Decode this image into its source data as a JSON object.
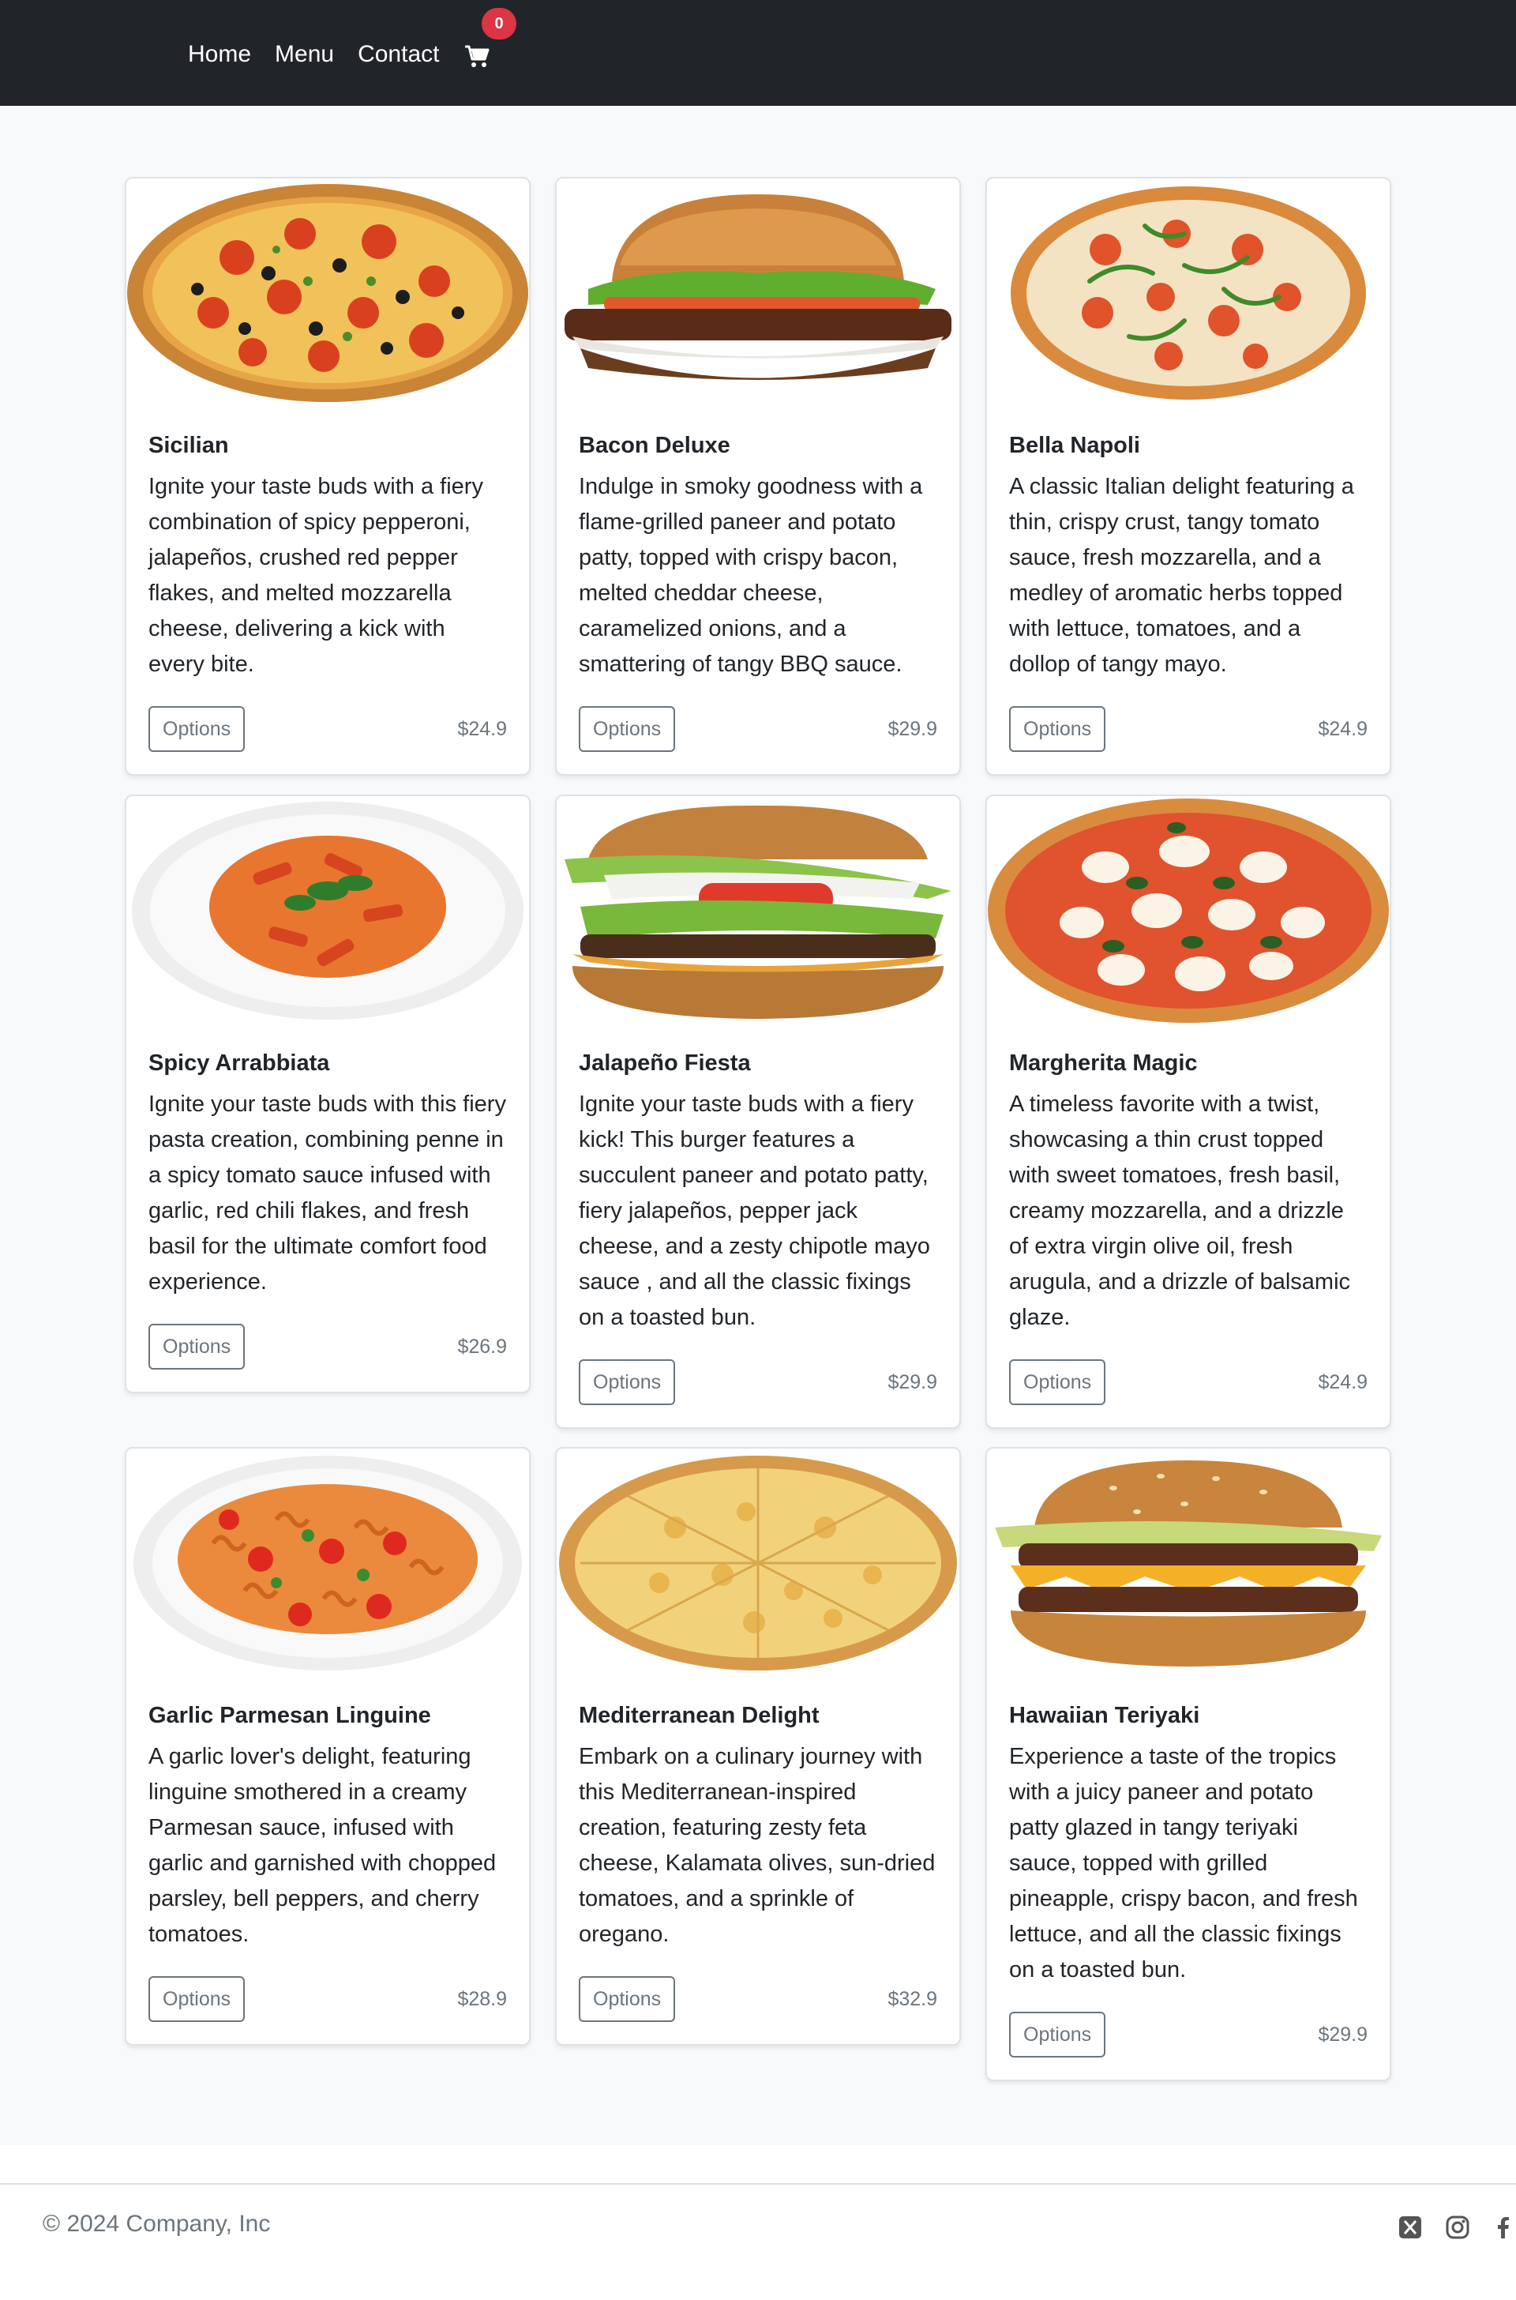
{
  "navbar": {
    "links": [
      "Home",
      "Menu",
      "Contact"
    ],
    "cart_count": "0",
    "cart_icon": "shopping-cart-icon"
  },
  "menu": {
    "items": [
      {
        "title": "Sicilian",
        "description": "Ignite your taste buds with a fiery combination of spicy pepperoni, jalapeños, crushed red pepper flakes, and melted mozzarella cheese, delivering a kick with every bite.",
        "price": "$24.9",
        "button": "Options",
        "image": "pizza-pepperoni-olives"
      },
      {
        "title": "Bacon Deluxe",
        "description": "Indulge in smoky goodness with a flame-grilled paneer and potato patty, topped with crispy bacon, melted cheddar cheese, caramelized onions, and a smattering of tangy BBQ sauce.",
        "price": "$29.9",
        "button": "Options",
        "image": "burger-bacon"
      },
      {
        "title": "Bella Napoli",
        "description": "A classic Italian delight featuring a thin, crispy crust, tangy tomato sauce, fresh mozzarella, and a medley of aromatic herbs topped with lettuce, tomatoes, and a dollop of tangy mayo.",
        "price": "$24.9",
        "button": "Options",
        "image": "pizza-arugula"
      },
      {
        "title": "Spicy Arrabbiata",
        "description": "Ignite your taste buds with this fiery pasta creation, combining penne in a spicy tomato sauce infused with garlic, red chili flakes, and fresh basil for the ultimate comfort food experience.",
        "price": "$26.9",
        "button": "Options",
        "image": "pasta-penne"
      },
      {
        "title": "Jalapeño Fiesta",
        "description": "Ignite your taste buds with a fiery kick! This burger features a succulent paneer and potato patty, fiery jalapeños, pepper jack cheese, and a zesty chipotle mayo sauce , and all the classic fixings on a toasted bun.",
        "price": "$29.9",
        "button": "Options",
        "image": "burger-lettuce-tomato"
      },
      {
        "title": "Margherita Magic",
        "description": "A timeless favorite with a twist, showcasing a thin crust topped with sweet tomatoes, fresh basil, creamy mozzarella, and a drizzle of extra virgin olive oil, fresh arugula, and a drizzle of balsamic glaze.",
        "price": "$24.9",
        "button": "Options",
        "image": "pizza-margherita"
      },
      {
        "title": "Garlic Parmesan Linguine",
        "description": "A garlic lover's delight, featuring linguine smothered in a creamy Parmesan sauce, infused with garlic and garnished with chopped parsley, bell peppers, and cherry tomatoes.",
        "price": "$28.9",
        "button": "Options",
        "image": "pasta-fusilli"
      },
      {
        "title": "Mediterranean Delight",
        "description": "Embark on a culinary journey with this Mediterranean-inspired creation, featuring zesty feta cheese, Kalamata olives, sun-dried tomatoes, and a sprinkle of oregano.",
        "price": "$32.9",
        "button": "Options",
        "image": "pizza-cheese"
      },
      {
        "title": "Hawaiian Teriyaki",
        "description": "Experience a taste of the tropics with a juicy paneer and potato patty glazed in tangy teriyaki sauce, topped with grilled pineapple, crispy bacon, and fresh lettuce, and all the classic fixings on a toasted bun.",
        "price": "$29.9",
        "button": "Options",
        "image": "burger-double-cheese"
      }
    ]
  },
  "footer": {
    "copyright": "© 2024 Company, Inc",
    "social": [
      "x-icon",
      "instagram-icon",
      "facebook-icon"
    ]
  },
  "colors": {
    "navbar_bg": "#212529",
    "badge": "#dc3545",
    "page_bg": "#f8f9fa",
    "muted": "#6c757d"
  }
}
